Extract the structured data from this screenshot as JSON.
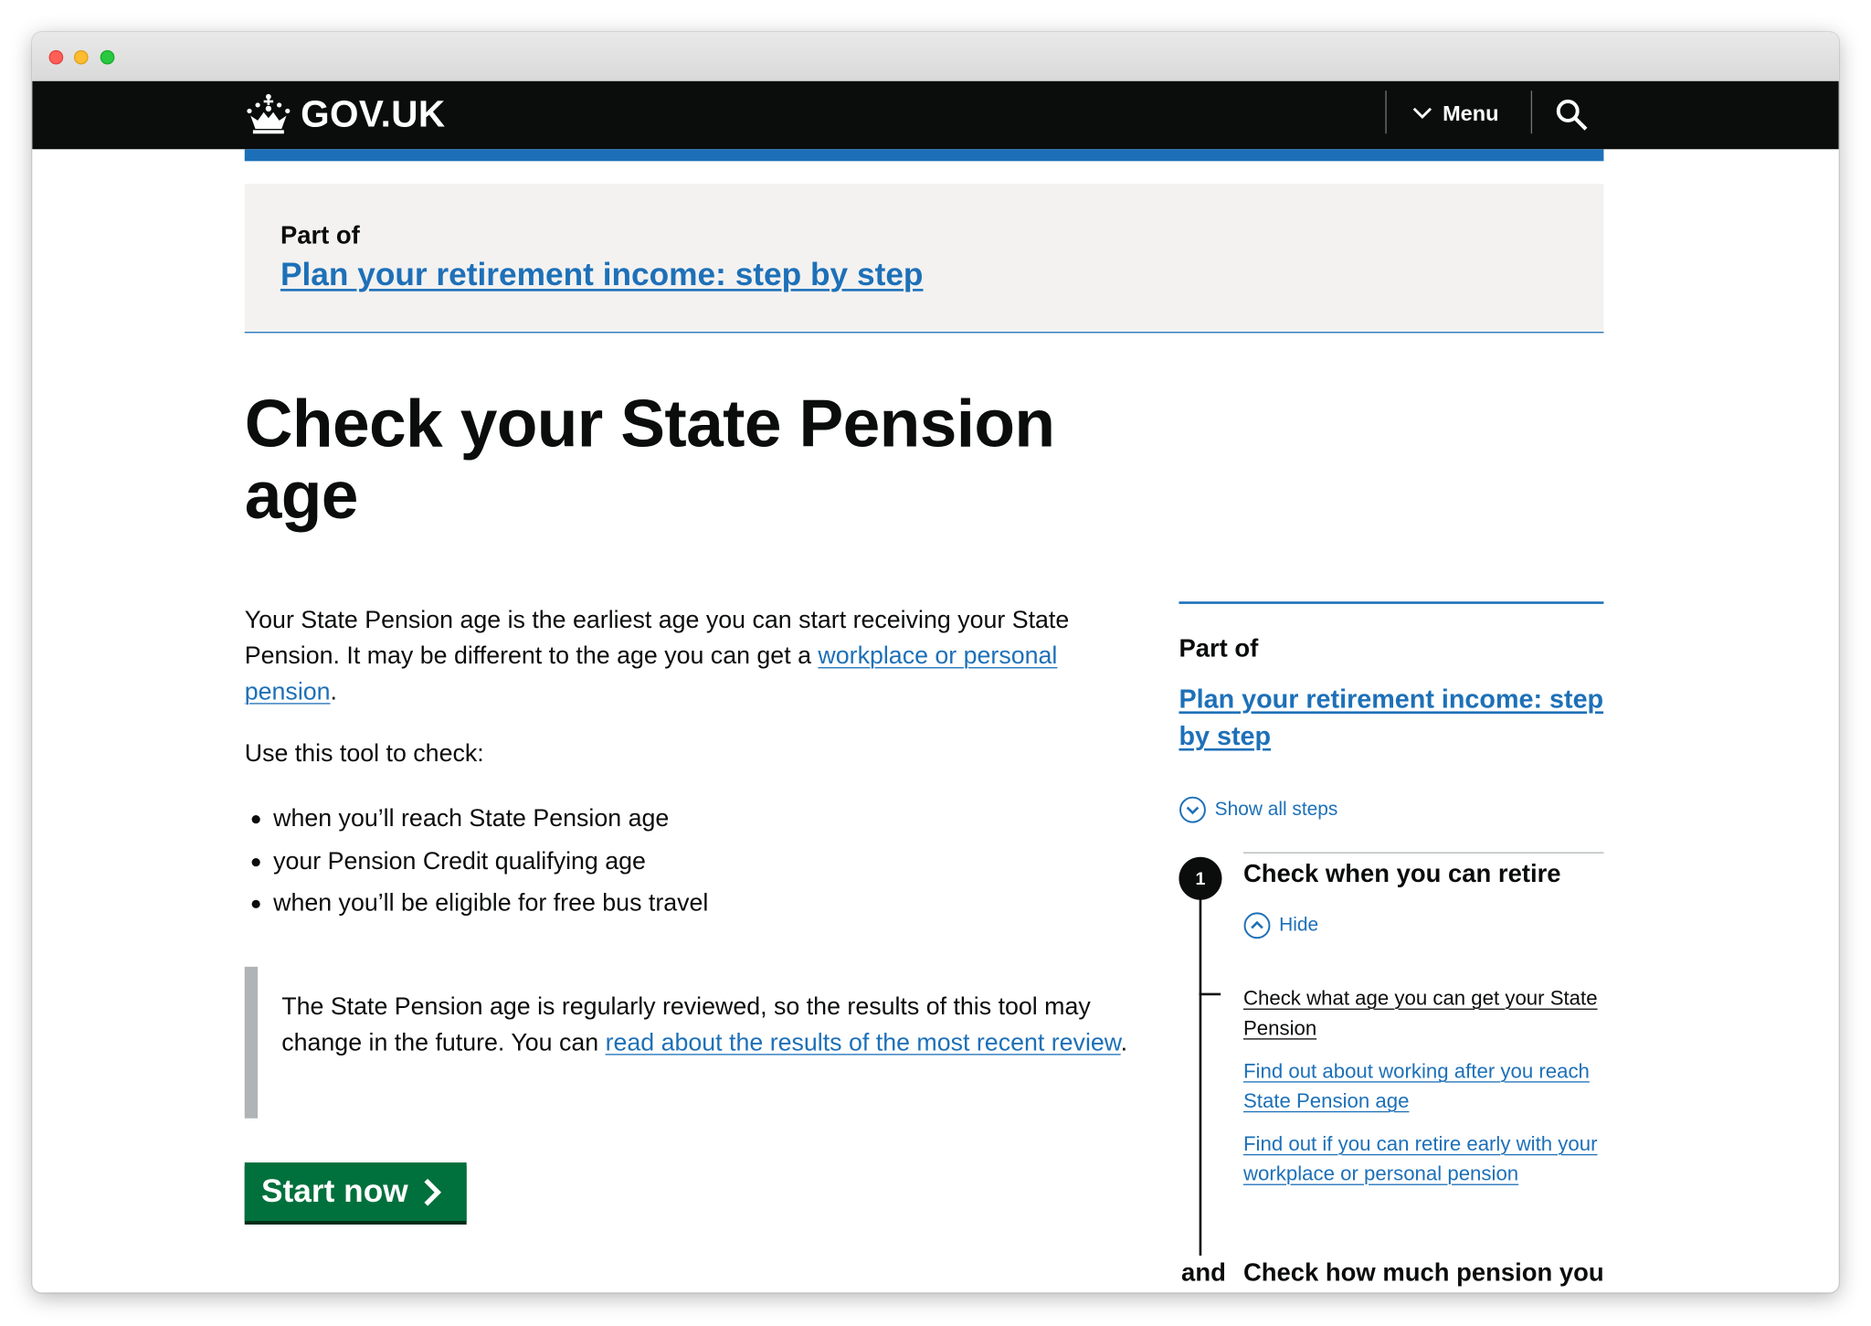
{
  "header": {
    "logo_text": "GOV.UK",
    "menu_label": "Menu",
    "icons": [
      "crown-icon",
      "chevron-down-icon",
      "search-icon"
    ]
  },
  "part_of_banner": {
    "label": "Part of",
    "link_text": "Plan your retirement income: step by step"
  },
  "page_title": "Check your State Pension age",
  "main": {
    "intro_before_link": "Your State Pension age is the earliest age you can start receiving your State Pension. It may be different to the age you can get a ",
    "intro_link": "workplace or personal pension",
    "intro_after_link": ".",
    "use_tool": "Use this tool to check:",
    "bullets": [
      "when you’ll reach State Pension age",
      "your Pension Credit qualifying age",
      "when you’ll be eligible for free bus travel"
    ],
    "inset_before_link": "The State Pension age is regularly reviewed, so the results of this tool may change in the future. You can ",
    "inset_link": "read about the results of the most recent review",
    "inset_after_link": ".",
    "start_button": "Start now"
  },
  "sidebar": {
    "part_of_label": "Part of",
    "link_text": "Plan your retirement income: step by step",
    "show_all": "Show all steps",
    "step1": {
      "number": "1",
      "title": "Check when you can retire",
      "toggle": "Hide",
      "links": [
        "Check what age you can get your State Pension",
        "Find out about working after you reach State Pension age",
        "Find out if you can retire early with your workplace or personal pension"
      ]
    },
    "and_label": "and",
    "step2_title": "Check how much pension you"
  },
  "colors": {
    "header_bg": "#0b0c0c",
    "brand_blue": "#1d70b8",
    "link": "#1d70b8",
    "start_button": "#00703c",
    "panel_bg": "#f3f2f1",
    "inset_bar": "#b1b4b6"
  }
}
